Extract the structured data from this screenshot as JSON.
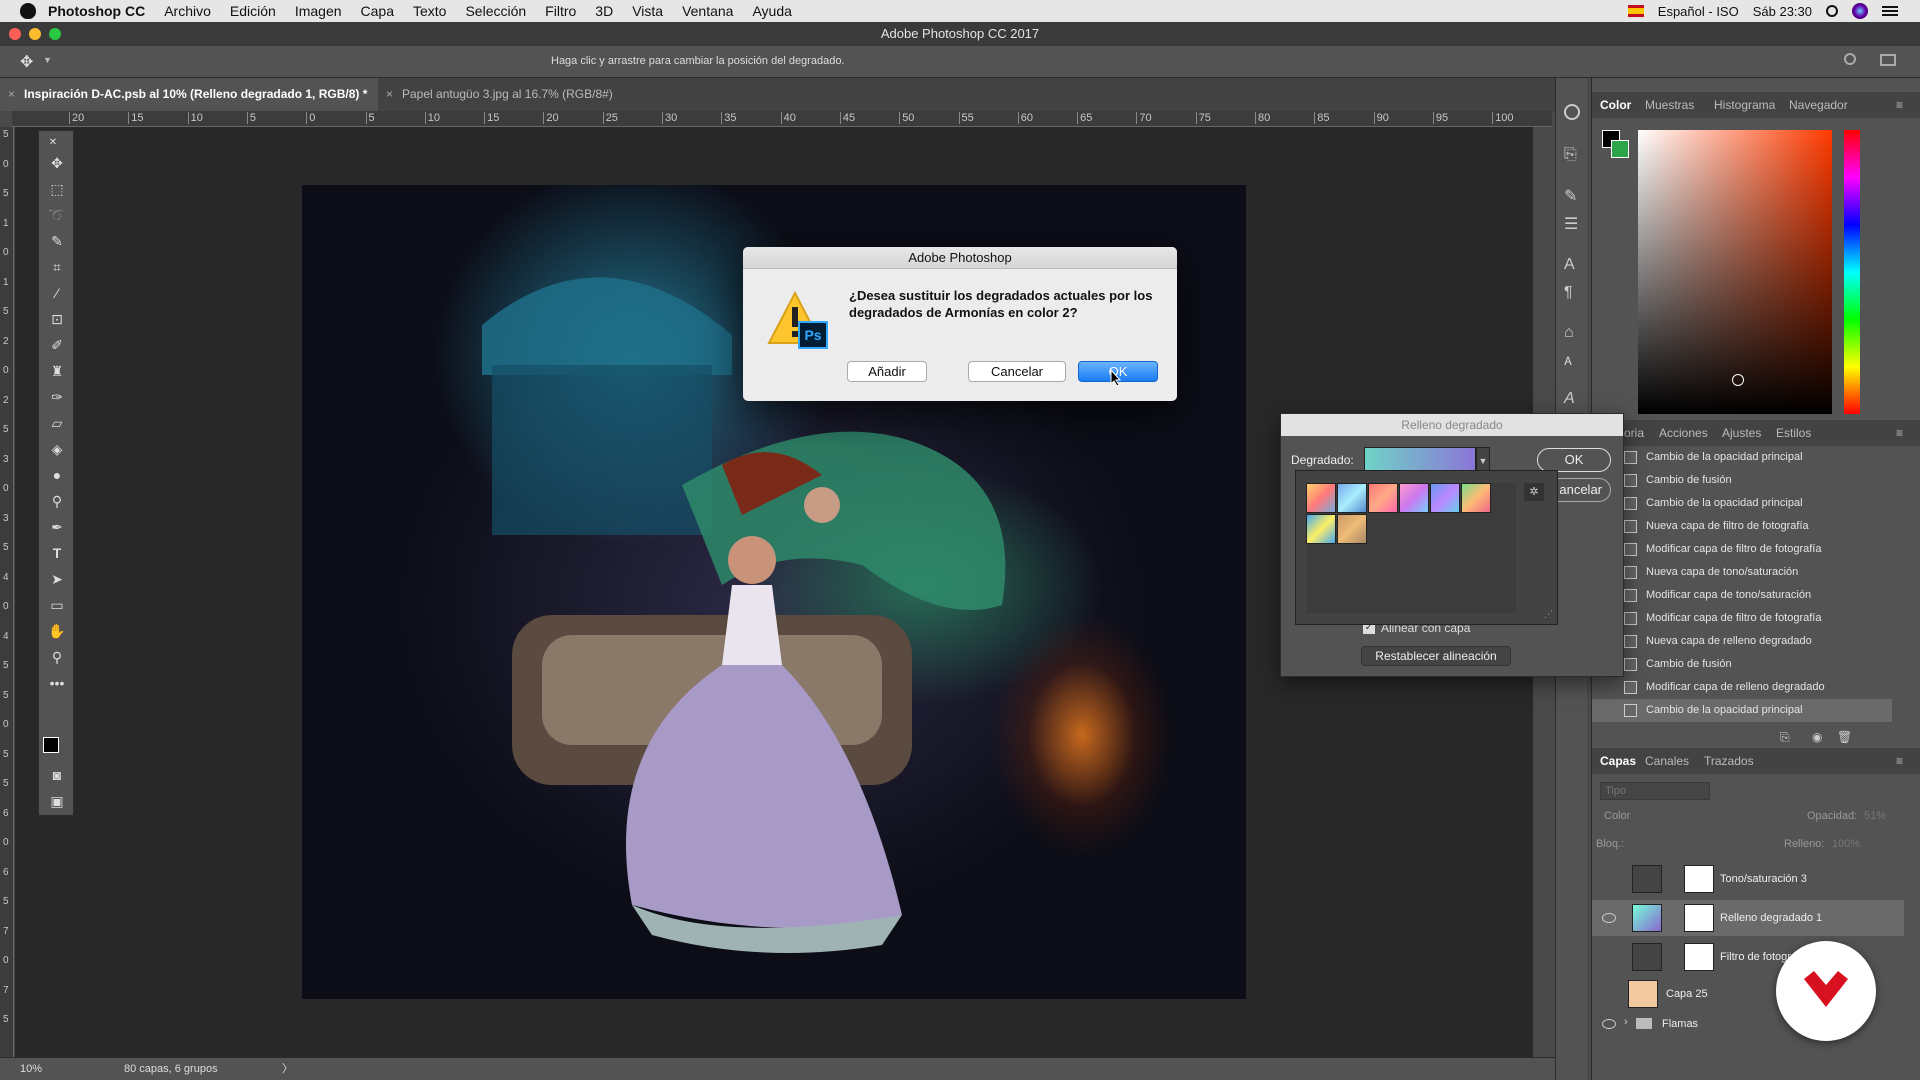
{
  "menubar": {
    "app": "Photoshop CC",
    "items": [
      "Archivo",
      "Edición",
      "Imagen",
      "Capa",
      "Texto",
      "Selección",
      "Filtro",
      "3D",
      "Vista",
      "Ventana",
      "Ayuda"
    ],
    "input_source": "Español - ISO",
    "clock": "Sáb 23:30"
  },
  "window": {
    "title": "Adobe Photoshop CC 2017"
  },
  "options_bar": {
    "hint": "Haga clic y arrastre para cambiar la posición del degradado."
  },
  "tabs": [
    {
      "label": "Inspiración D-AC.psb al 10% (Relleno degradado 1, RGB/8) *",
      "close": "×"
    },
    {
      "label": "Papel antugüo 3.jpg al 16.7% (RGB/8#)",
      "close": "×"
    }
  ],
  "ruler": {
    "h_ticks": [
      "20",
      "15",
      "10",
      "5",
      "0",
      "5",
      "10",
      "15",
      "20",
      "25",
      "30",
      "35",
      "40",
      "45",
      "50",
      "55",
      "60",
      "65",
      "70",
      "75",
      "80",
      "85",
      "90",
      "95",
      "100"
    ],
    "v_ticks": [
      "5",
      "0",
      "5",
      "1",
      "0",
      "1",
      "5",
      "2",
      "0",
      "2",
      "5",
      "3",
      "0",
      "3",
      "5",
      "4",
      "0",
      "4",
      "5",
      "5",
      "0",
      "5",
      "5",
      "6",
      "0",
      "6",
      "5",
      "7",
      "0",
      "7",
      "5"
    ]
  },
  "status": {
    "zoom": "10%",
    "info": "80 capas, 6 grupos",
    "arrow": "〉"
  },
  "color_panel": {
    "tabs": [
      "Color",
      "Muestras",
      "Histograma",
      "Navegador"
    ],
    "fg": "#000000",
    "bg": "#2ca54a"
  },
  "history_panel": {
    "tabs": [
      "oria",
      "Acciones",
      "Ajustes",
      "Estilos"
    ],
    "items": [
      "Cambio de la opacidad principal",
      "Cambio de fusión",
      "Cambio de la opacidad principal",
      "Nueva capa de filtro de fotografía",
      "Modificar capa de filtro de fotografía",
      "Nueva capa de tono/saturación",
      "Modificar capa de tono/saturación",
      "Modificar capa de filtro de fotografía",
      "Nueva capa de relleno degradado",
      "Cambio de fusión",
      "Modificar capa de relleno degradado",
      "Cambio de la opacidad principal"
    ]
  },
  "layers_panel": {
    "tabs": [
      "Capas",
      "Canales",
      "Trazados"
    ],
    "filter_placeholder": "Tipo",
    "blend_mode": "Color",
    "opacity_label": "Opacidad:",
    "opacity_value": "51%",
    "lock_label": "Bloq.:",
    "fill_label": "Relleno:",
    "fill_value": "100%",
    "layers": [
      {
        "name": "Tono/saturación 3",
        "visible": false
      },
      {
        "name": "Relleno degradado 1",
        "visible": true
      },
      {
        "name": "Filtro de fotogra",
        "visible": false
      },
      {
        "name": "Capa 25",
        "visible": false
      },
      {
        "name": "Flamas",
        "visible": true
      }
    ]
  },
  "alert_dialog": {
    "title": "Adobe Photoshop",
    "message": "¿Desea sustituir los degradados actuales por los degradados de Armonías en color 2?",
    "buttons": {
      "add": "Añadir",
      "cancel": "Cancelar",
      "ok": "OK"
    },
    "ps_badge": "Ps"
  },
  "gradient_dialog": {
    "title": "Relleno degradado",
    "label": "Degradado:",
    "ok": "OK",
    "cancel": "ancelar",
    "align_label": "Alinear con capa",
    "reset": "Restablecer alineación"
  }
}
